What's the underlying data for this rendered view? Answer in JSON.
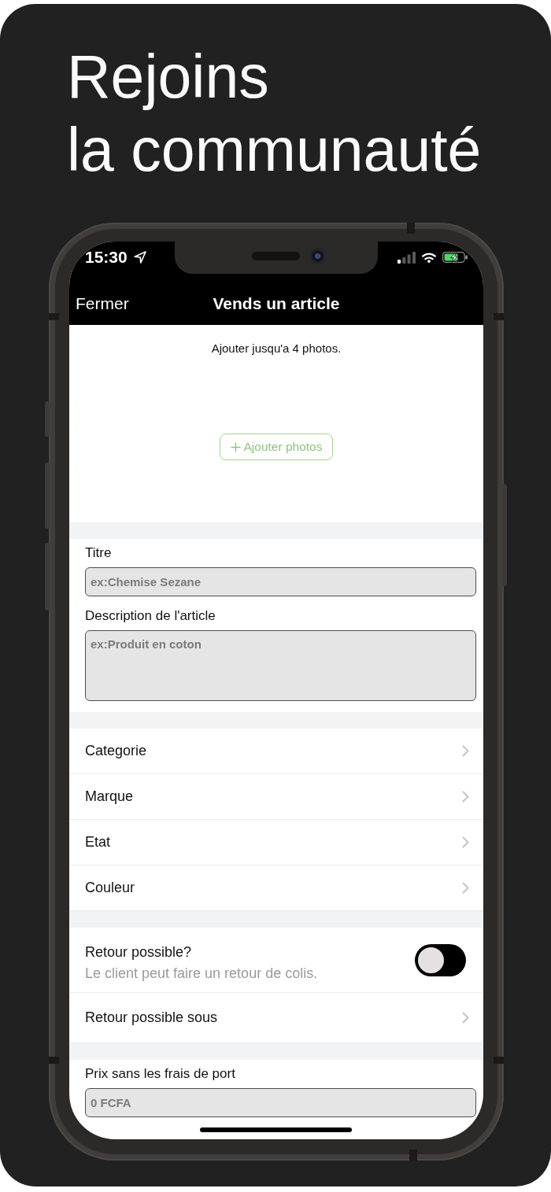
{
  "headline": {
    "lines": [
      "Rejoins",
      "la communauté"
    ]
  },
  "status_bar": {
    "time": "15:30"
  },
  "nav_bar": {
    "close": "Fermer",
    "title": "Vends un article"
  },
  "photos": {
    "hint": "Ajouter jusqu'a 4 photos.",
    "button": "Ajouter photos"
  },
  "details": [
    {
      "kind": "input",
      "label": "Titre",
      "placeholder": "ex:Chemise Sezane"
    },
    {
      "kind": "textarea",
      "label": "Description de l'article",
      "placeholder": "ex:Produit en coton"
    }
  ],
  "attributes": [
    {
      "label": "Categorie"
    },
    {
      "label": "Marque"
    },
    {
      "label": "Etat"
    },
    {
      "label": "Couleur"
    }
  ],
  "returns": [
    {
      "kind": "switch",
      "label": "Retour possible?",
      "description": "Le client peut faire un retour de colis.",
      "on": false
    },
    {
      "kind": "picker",
      "label": "Retour possible sous"
    }
  ],
  "price": {
    "label": "Prix sans les frais de port",
    "placeholder": "0 FCFA"
  }
}
